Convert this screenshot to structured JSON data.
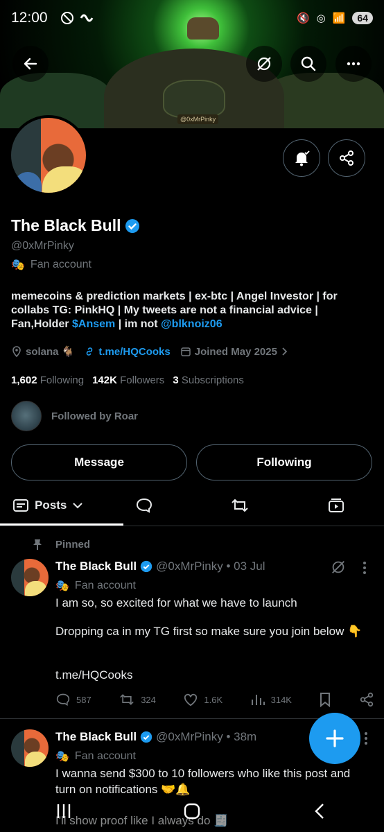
{
  "status_bar": {
    "time": "12:00",
    "battery": "64"
  },
  "banner": {
    "tag": "@0xMrPinky"
  },
  "profile": {
    "name": "The Black Bull",
    "handle": "@0xMrPinky",
    "label": "Fan account",
    "bio_part1": "memecoins & prediction markets | ex-btc | Angel Investor | for collabs TG: PinkHQ | My tweets are not a financial advice | Fan,Holder ",
    "bio_cashtag": "$Ansem",
    "bio_part2": " | im not ",
    "bio_mention": "@blknoiz06",
    "location": "solana 🐐",
    "link": "t.me/HQCooks",
    "joined": "Joined May 2025",
    "following_count": "1,602",
    "following_label": "Following",
    "followers_count": "142K",
    "followers_label": "Followers",
    "subs_count": "3",
    "subs_label": "Subscriptions",
    "followed_by": "Followed by Roar"
  },
  "buttons": {
    "message": "Message",
    "following": "Following"
  },
  "tabs": {
    "posts": "Posts"
  },
  "posts": [
    {
      "pinned_label": "Pinned",
      "name": "The Black Bull",
      "handle_time": "@0xMrPinky • 03 Jul",
      "label": "Fan account",
      "line1": "I am so, so excited for what we have to launch",
      "line2": "Dropping ca in my TG first so make sure you join below 👇",
      "link": "t.me/HQCooks",
      "replies": "587",
      "reposts": "324",
      "likes": "1.6K",
      "views": "314K"
    },
    {
      "name": "The Black Bull",
      "handle_time": "@0xMrPinky • 38m",
      "label": "Fan account",
      "line1": "I wanna send $300 to 10 followers who like this post and turn on notifications 🤝🔔",
      "line2": "I'll show proof like I always do 🧾"
    }
  ],
  "colors": {
    "accent": "#1d9bf0",
    "muted": "#71767b",
    "border": "#536471"
  }
}
